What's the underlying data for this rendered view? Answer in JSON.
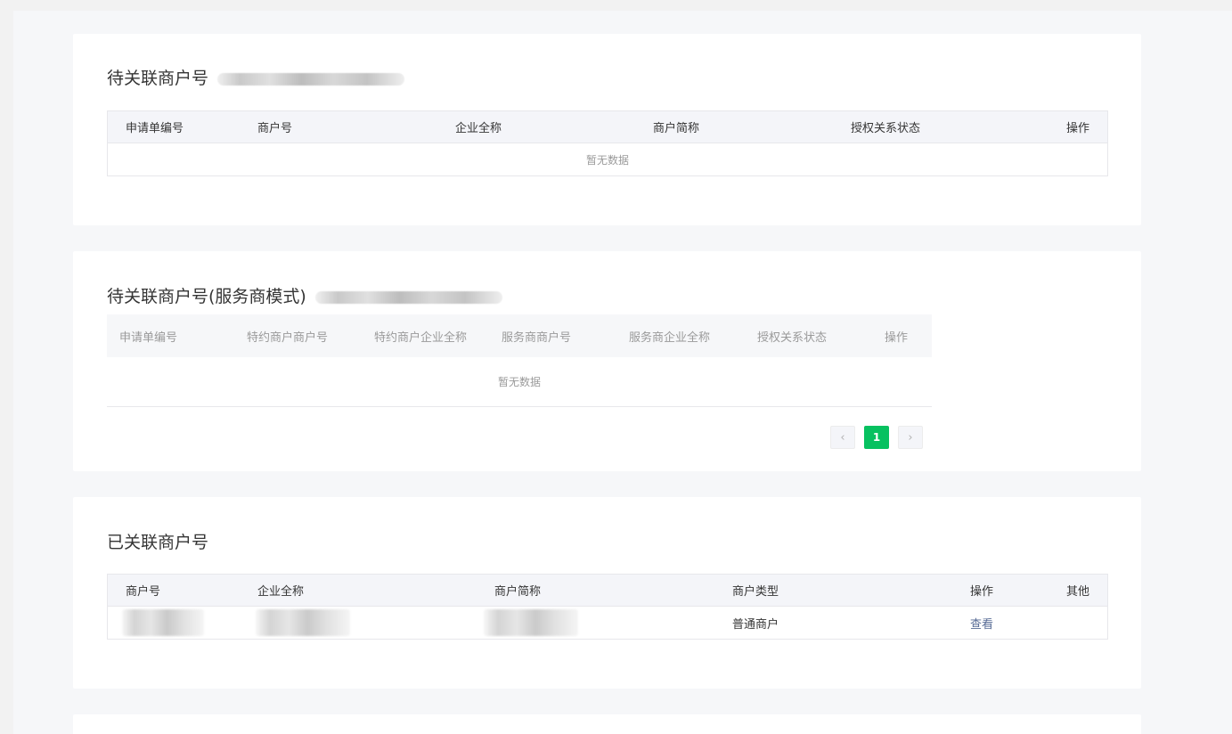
{
  "section_pending": {
    "title": "待关联商户号",
    "columns": [
      "申请单编号",
      "商户号",
      "企业全称",
      "商户简称",
      "授权关系状态",
      "操作"
    ],
    "empty_text": "暂无数据"
  },
  "section_service": {
    "title": "待关联商户号(服务商模式)",
    "columns": [
      "申请单编号",
      "特约商户商户号",
      "特约商户企业全称",
      "服务商商户号",
      "服务商企业全称",
      "授权关系状态",
      "操作"
    ],
    "empty_text": "暂无数据",
    "pagination": {
      "current_page": "1",
      "prev_icon": "‹",
      "next_icon": "›"
    }
  },
  "section_linked": {
    "title": "已关联商户号",
    "columns": [
      "商户号",
      "企业全称",
      "商户简称",
      "商户类型",
      "操作",
      "其他"
    ],
    "rows": [
      {
        "merchant_type": "普通商户",
        "action": "查看"
      }
    ]
  },
  "colors": {
    "accent": "#07c160",
    "link": "#576b95"
  }
}
